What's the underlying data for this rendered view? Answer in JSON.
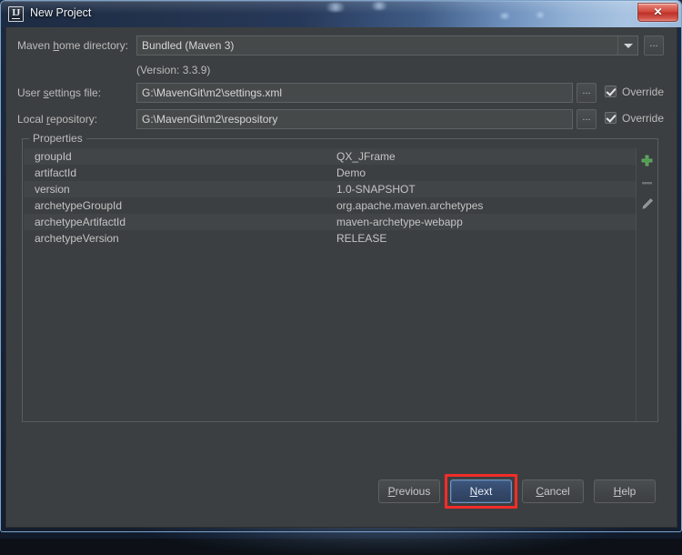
{
  "window": {
    "title": "New Project",
    "app_icon": "IJ",
    "close_label": "✕"
  },
  "form": {
    "maven_home": {
      "label_pre": "Maven ",
      "label_mnemonic": "h",
      "label_post": "ome directory:",
      "value": "Bundled (Maven 3)",
      "browse_label": "...",
      "version_note": "(Version: 3.3.9)"
    },
    "user_settings": {
      "label_pre": "User ",
      "label_mnemonic": "s",
      "label_post": "ettings file:",
      "value": "G:\\MavenGit\\m2\\settings.xml",
      "browse_label": "...",
      "override_label": "Override",
      "override_checked": true
    },
    "local_repository": {
      "label_pre": "Local ",
      "label_mnemonic": "r",
      "label_post": "epository:",
      "value": "G:\\MavenGit\\m2\\respository",
      "browse_label": "...",
      "override_label": "Override",
      "override_checked": true
    }
  },
  "properties": {
    "legend": "Properties",
    "rows": [
      {
        "name": "groupId",
        "value": "QX_JFrame"
      },
      {
        "name": "artifactId",
        "value": "Demo"
      },
      {
        "name": "version",
        "value": "1.0-SNAPSHOT"
      },
      {
        "name": "archetypeGroupId",
        "value": "org.apache.maven.archetypes"
      },
      {
        "name": "archetypeArtifactId",
        "value": "maven-archetype-webapp"
      },
      {
        "name": "archetypeVersion",
        "value": "RELEASE"
      }
    ],
    "toolbar": {
      "add": "add-property",
      "remove": "remove-property",
      "edit": "edit-property"
    }
  },
  "buttons": {
    "previous": {
      "pre": "",
      "mnemonic": "P",
      "post": "revious"
    },
    "next": {
      "pre": "",
      "mnemonic": "N",
      "post": "ext"
    },
    "cancel": {
      "pre": "",
      "mnemonic": "C",
      "post": "ancel"
    },
    "help": {
      "pre": "",
      "mnemonic": "H",
      "post": "elp"
    }
  },
  "colors": {
    "dialog_background": "#3c3f41",
    "field_background": "#45494a",
    "text": "#bbbbbb",
    "primary_button": "#34496b",
    "highlight_box": "#f22c28",
    "add_icon": "#4f9b4f",
    "close_button": "#cf4237"
  }
}
